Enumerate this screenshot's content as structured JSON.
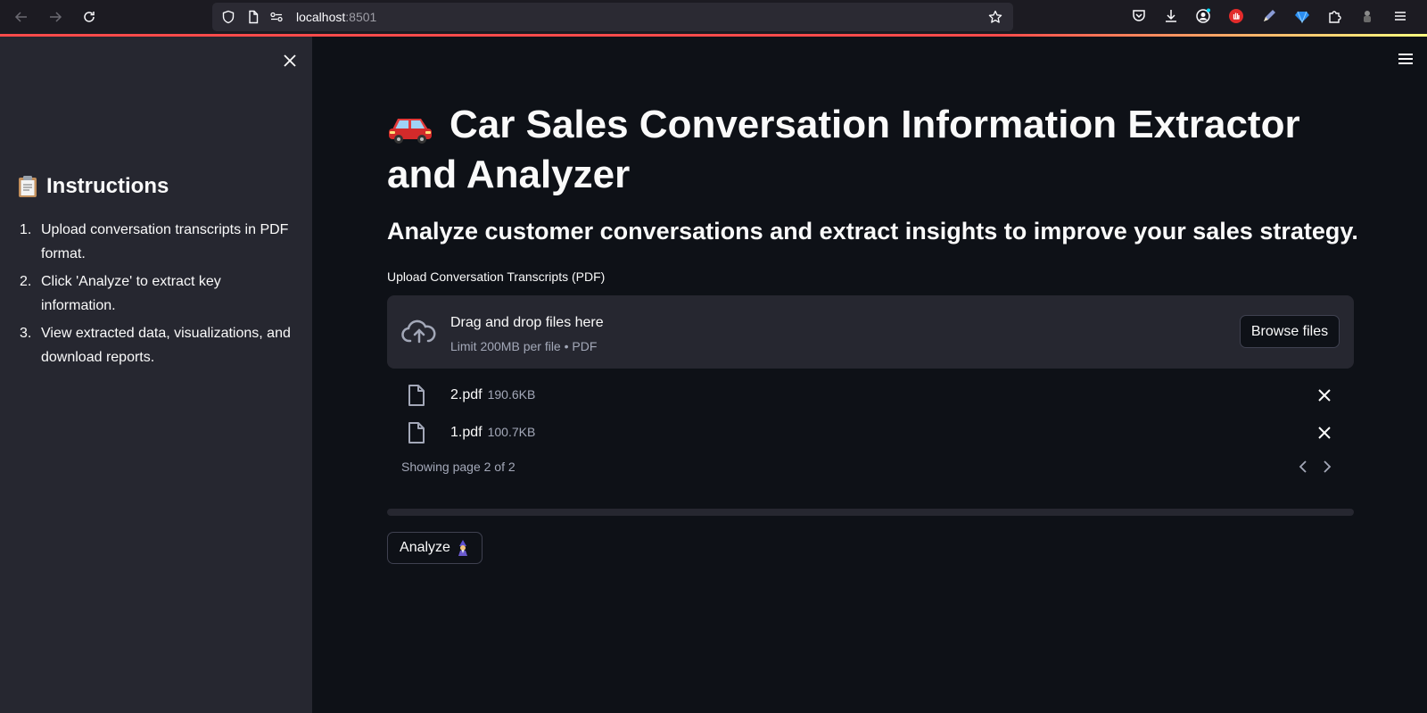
{
  "browser": {
    "url_host": "localhost",
    "url_port": ":8501"
  },
  "sidebar": {
    "title": "Instructions",
    "items": [
      {
        "num": "1.",
        "text": "Upload conversation transcripts in PDF format."
      },
      {
        "num": "2.",
        "text": "Click 'Analyze' to extract key information."
      },
      {
        "num": "3.",
        "text": "View extracted data, visualizations, and download reports."
      }
    ]
  },
  "main": {
    "title": "Car Sales Conversation Information Extractor and Analyzer",
    "subtitle": "Analyze customer conversations and extract insights to improve your sales strategy.",
    "uploader": {
      "label": "Upload Conversation Transcripts (PDF)",
      "drag_text": "Drag and drop files here",
      "limit_text": "Limit 200MB per file • PDF",
      "browse_label": "Browse files"
    },
    "files": [
      {
        "name": "2.pdf",
        "size": "190.6KB"
      },
      {
        "name": "1.pdf",
        "size": "100.7KB"
      }
    ],
    "pagination": "Showing page 2 of 2",
    "analyze_label": "Analyze"
  },
  "colors": {
    "background": "#0e1117",
    "sidebar": "#262730",
    "text": "#fafafa",
    "muted": "#a3a8b8",
    "accent": "#ff4b4b"
  }
}
